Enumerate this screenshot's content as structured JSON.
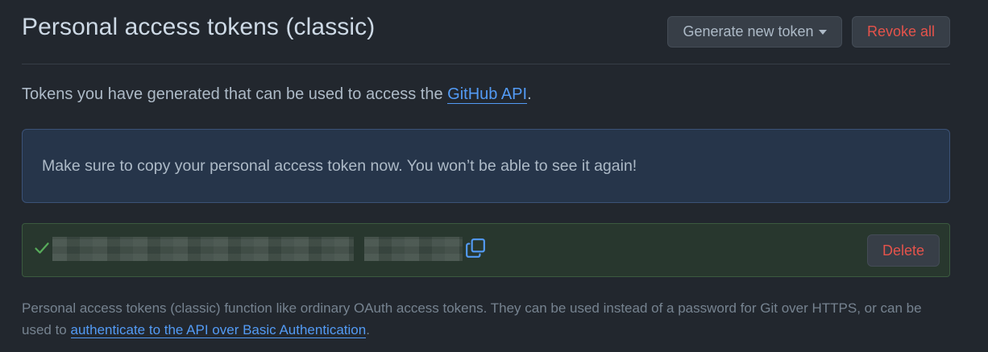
{
  "header": {
    "title": "Personal access tokens (classic)",
    "generate_label": "Generate new token",
    "revoke_label": "Revoke all"
  },
  "intro": {
    "text": "Tokens you have generated that can be used to access the ",
    "link": "GitHub API",
    "suffix": "."
  },
  "flash": {
    "message": "Make sure to copy your personal access token now. You won’t be able to see it again!"
  },
  "token": {
    "status_icon": "check-icon",
    "copy_icon": "copy-icon",
    "delete_label": "Delete"
  },
  "note": {
    "text": "Personal access tokens (classic) function like ordinary OAuth access tokens. They can be used instead of a password for Git over HTTPS, or can be used to ",
    "link": "authenticate to the API over Basic Authentication",
    "suffix": "."
  },
  "colors": {
    "background": "#22272e",
    "link": "#539bf5",
    "danger": "#e5534b",
    "success": "#57ab5a"
  }
}
